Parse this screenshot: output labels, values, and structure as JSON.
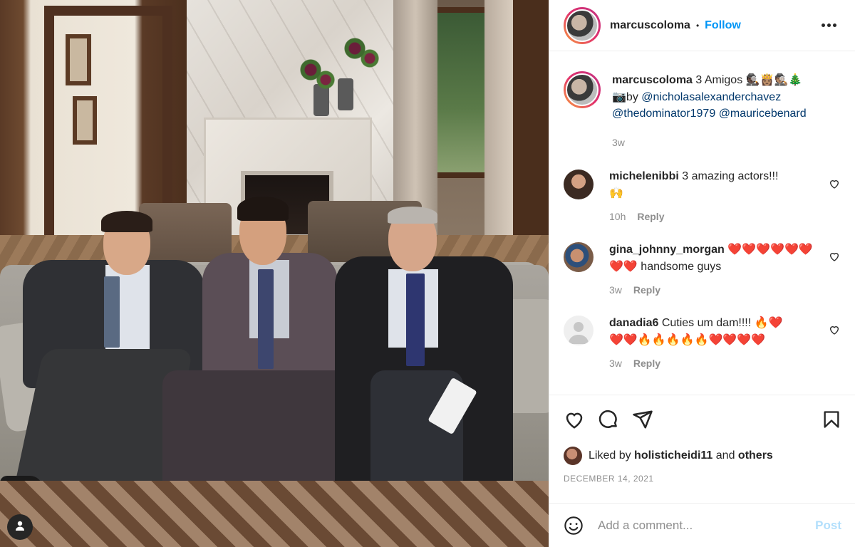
{
  "post": {
    "author": "marcuscoloma",
    "follow_label": "Follow",
    "separator": "•",
    "caption_text": "3 Amigos",
    "caption_emojis": "🕵🏿👸🏽🕵🏽🎄",
    "camera_emoji": "📷",
    "by_text": "by",
    "mentions": [
      "@nicholasalexanderchavez",
      "@thedominator1979",
      "@mauricebenard"
    ],
    "caption_age": "3w",
    "liked_by_prefix": "Liked by",
    "liked_by_user": "holisticheidi11",
    "liked_by_and": "and",
    "liked_by_others": "others",
    "date": "DECEMBER 14, 2021"
  },
  "comments": [
    {
      "user": "michelenibbi",
      "text": "3 amazing actors!!!",
      "emoji": "🙌",
      "age": "10h",
      "reply": "Reply"
    },
    {
      "user": "gina_johnny_morgan",
      "emoji": "❤️❤️❤️❤️❤️❤️❤️❤️",
      "text": "handsome guys",
      "age": "3w",
      "reply": "Reply"
    },
    {
      "user": "danadia6",
      "text": "Cuties um dam!!!!",
      "emoji": "🔥❤️",
      "emoji2": "❤️❤️🔥🔥🔥🔥🔥❤️❤️❤️❤️",
      "age": "3w",
      "reply": "Reply"
    }
  ],
  "composer": {
    "placeholder": "Add a comment...",
    "post_label": "Post"
  },
  "icons": {
    "more": "more-options-icon",
    "like": "heart-icon",
    "comment": "comment-icon",
    "share": "paper-plane-icon",
    "save": "bookmark-icon",
    "emoji": "smiley-icon",
    "user": "user-icon"
  },
  "colors": {
    "link": "#0095f6",
    "mention": "#00376b",
    "muted": "#8e8e8e",
    "post_disabled": "#b2dffc"
  }
}
